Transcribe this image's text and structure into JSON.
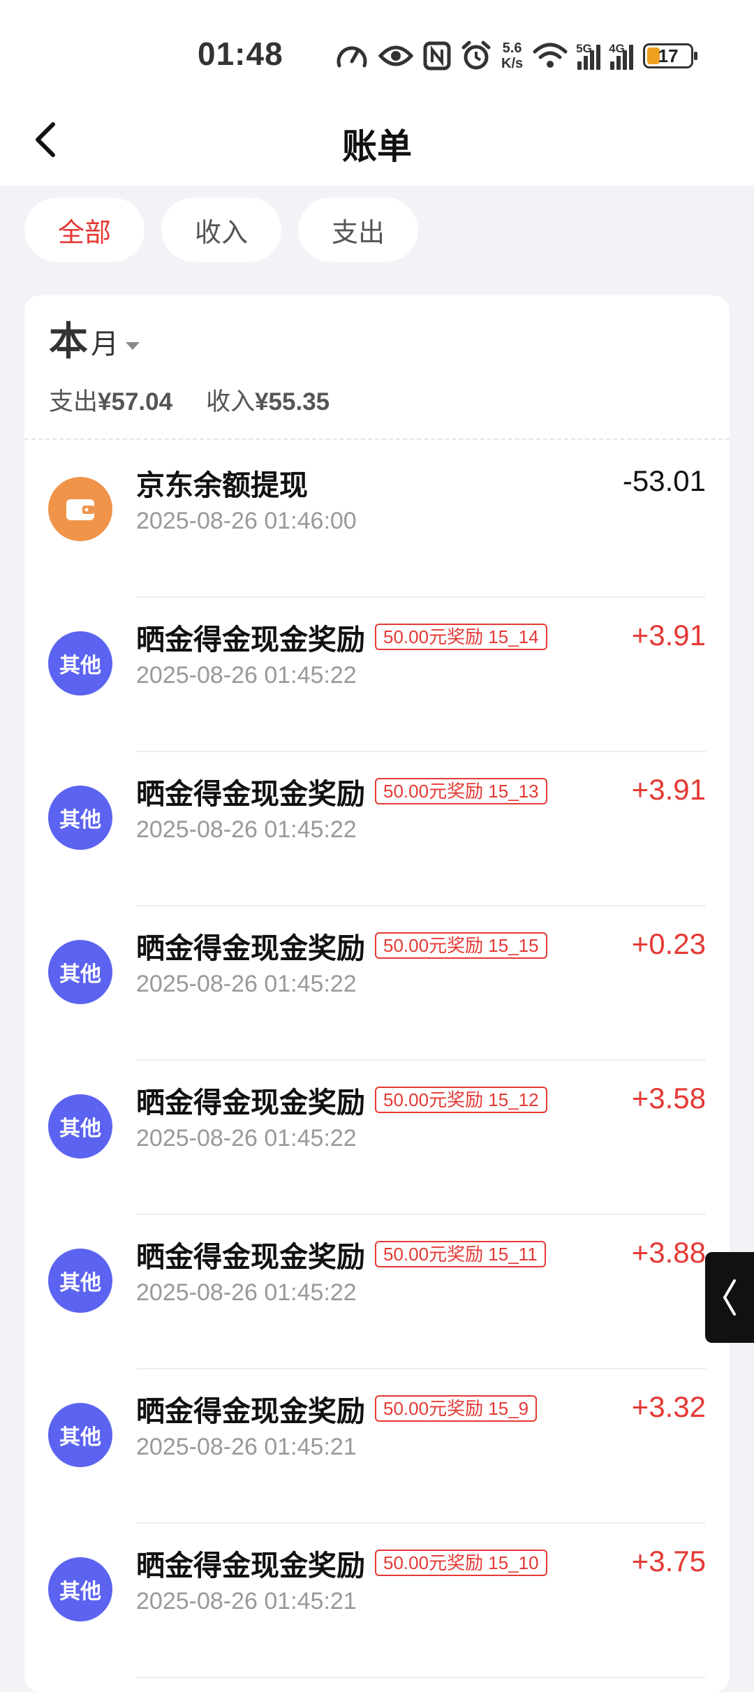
{
  "status": {
    "time": "01:48",
    "net_speed_value": "5.6",
    "net_speed_unit": "K/s",
    "sig1_label": "5G",
    "sig2_label": "4G",
    "battery": "17"
  },
  "nav": {
    "title": "账单"
  },
  "filters": [
    {
      "label": "全部",
      "active": true
    },
    {
      "label": "收入",
      "active": false
    },
    {
      "label": "支出",
      "active": false
    }
  ],
  "period": {
    "big": "本",
    "small": "月",
    "expense_label": "支出",
    "expense_value": "¥57.04",
    "income_label": "收入",
    "income_value": "¥55.35"
  },
  "transactions": [
    {
      "icon": "wallet-icon",
      "icon_text": "",
      "title": "京东余额提现",
      "tag": "",
      "date": "2025-08-26 01:46:00",
      "amount": "-53.01",
      "type": "expense"
    },
    {
      "icon": "other-icon",
      "icon_text": "其他",
      "title": "晒金得金现金奖励",
      "tag": "50.00元奖励 15_14",
      "date": "2025-08-26 01:45:22",
      "amount": "+3.91",
      "type": "income"
    },
    {
      "icon": "other-icon",
      "icon_text": "其他",
      "title": "晒金得金现金奖励",
      "tag": "50.00元奖励 15_13",
      "date": "2025-08-26 01:45:22",
      "amount": "+3.91",
      "type": "income"
    },
    {
      "icon": "other-icon",
      "icon_text": "其他",
      "title": "晒金得金现金奖励",
      "tag": "50.00元奖励 15_15",
      "date": "2025-08-26 01:45:22",
      "amount": "+0.23",
      "type": "income"
    },
    {
      "icon": "other-icon",
      "icon_text": "其他",
      "title": "晒金得金现金奖励",
      "tag": "50.00元奖励 15_12",
      "date": "2025-08-26 01:45:22",
      "amount": "+3.58",
      "type": "income"
    },
    {
      "icon": "other-icon",
      "icon_text": "其他",
      "title": "晒金得金现金奖励",
      "tag": "50.00元奖励 15_11",
      "date": "2025-08-26 01:45:22",
      "amount": "+3.88",
      "type": "income"
    },
    {
      "icon": "other-icon",
      "icon_text": "其他",
      "title": "晒金得金现金奖励",
      "tag": "50.00元奖励 15_9",
      "date": "2025-08-26 01:45:21",
      "amount": "+3.32",
      "type": "income"
    },
    {
      "icon": "other-icon",
      "icon_text": "其他",
      "title": "晒金得金现金奖励",
      "tag": "50.00元奖励 15_10",
      "date": "2025-08-26 01:45:21",
      "amount": "+3.75",
      "type": "income"
    }
  ],
  "colors": {
    "accent": "#e53935",
    "other_icon": "#5b63f0",
    "wallet_icon": "#f0944a"
  }
}
